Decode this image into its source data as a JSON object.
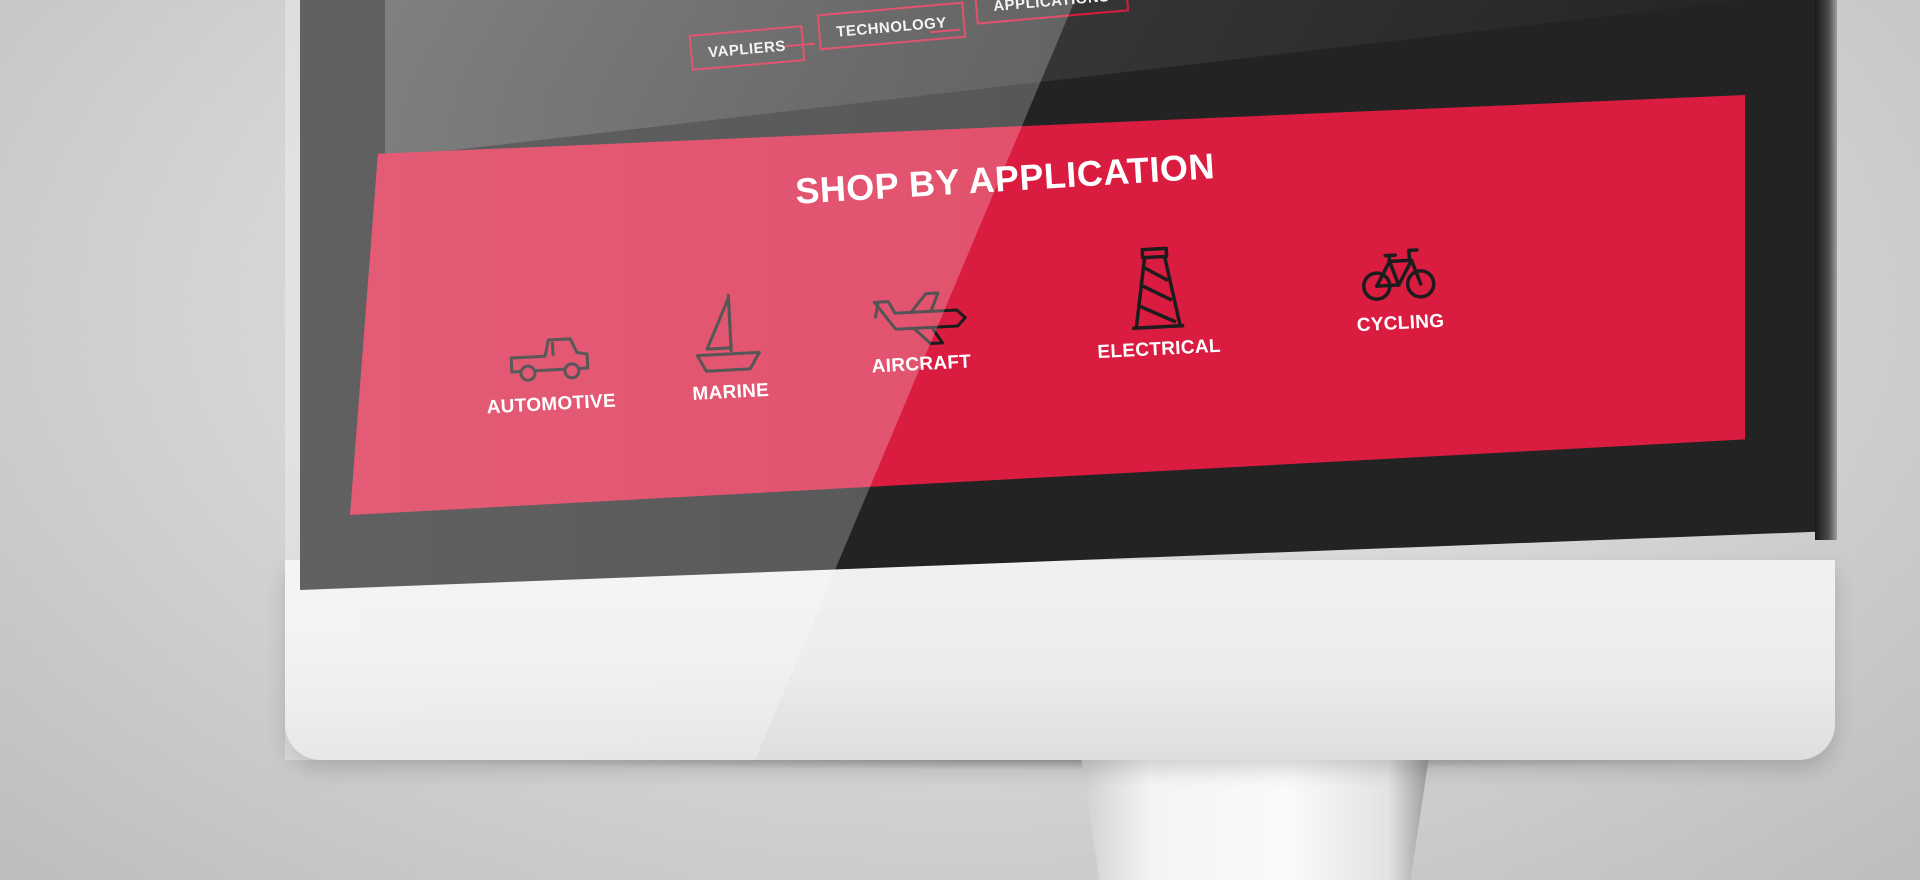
{
  "nav": {
    "chips": [
      {
        "label": "VAPLIERS"
      },
      {
        "label": "TECHNOLOGY"
      },
      {
        "label": "APPLICATIONS"
      }
    ]
  },
  "section": {
    "title": "SHOP BY APPLICATION",
    "items": [
      {
        "label": "AUTOMOTIVE",
        "icon": "truck-icon"
      },
      {
        "label": "MARINE",
        "icon": "sailboat-icon"
      },
      {
        "label": "AIRCRAFT",
        "icon": "airplane-icon"
      },
      {
        "label": "ELECTRICAL",
        "icon": "power-tower-icon"
      },
      {
        "label": "CYCLING",
        "icon": "bicycle-icon"
      }
    ]
  },
  "colors": {
    "accent": "#d91c40",
    "icon_stroke": "#1c1c1c",
    "text": "#ffffff"
  }
}
